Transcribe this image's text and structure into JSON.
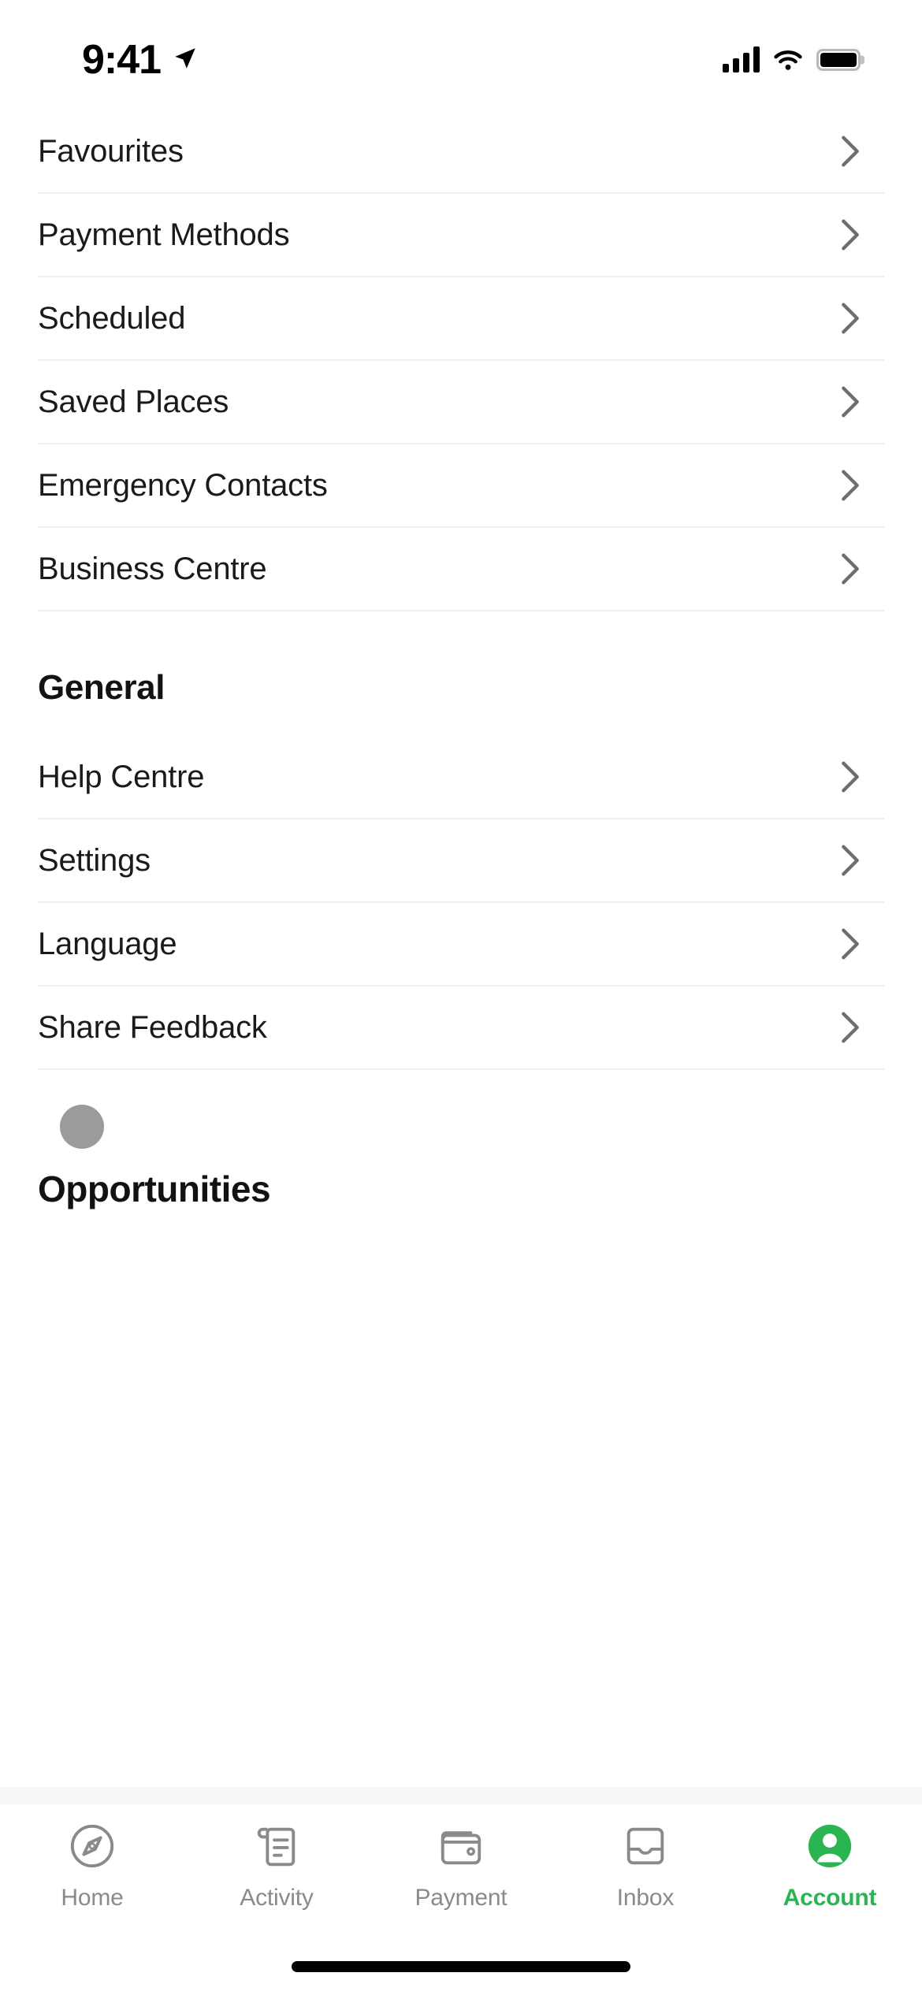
{
  "status_bar": {
    "time": "9:41",
    "location_icon": "location-arrow-icon",
    "signal_icon": "cellular-signal-icon",
    "wifi_icon": "wifi-icon",
    "battery_icon": "battery-full-icon"
  },
  "account_menu": {
    "items": [
      {
        "label": "Favourites",
        "chevron": "chevron-right-icon"
      },
      {
        "label": "Payment Methods",
        "chevron": "chevron-right-icon"
      },
      {
        "label": "Scheduled",
        "chevron": "chevron-right-icon"
      },
      {
        "label": "Saved Places",
        "chevron": "chevron-right-icon"
      },
      {
        "label": "Emergency Contacts",
        "chevron": "chevron-right-icon"
      },
      {
        "label": "Business Centre",
        "chevron": "chevron-right-icon"
      }
    ]
  },
  "general_section": {
    "title": "General",
    "items": [
      {
        "label": "Help Centre",
        "chevron": "chevron-right-icon"
      },
      {
        "label": "Settings",
        "chevron": "chevron-right-icon"
      },
      {
        "label": "Language",
        "chevron": "chevron-right-icon"
      },
      {
        "label": "Share Feedback",
        "chevron": "chevron-right-icon"
      }
    ]
  },
  "opportunities_section": {
    "title": "Opportunities",
    "badge_icon": "circle-placeholder-icon"
  },
  "tab_bar": {
    "tabs": [
      {
        "label": "Home",
        "icon": "compass-icon",
        "active": false
      },
      {
        "label": "Activity",
        "icon": "receipt-icon",
        "active": false
      },
      {
        "label": "Payment",
        "icon": "wallet-icon",
        "active": false
      },
      {
        "label": "Inbox",
        "icon": "inbox-tray-icon",
        "active": false
      },
      {
        "label": "Account",
        "icon": "person-filled-icon",
        "active": true
      }
    ]
  },
  "colors": {
    "accent_green": "#2ab552",
    "divider": "#eeeeee",
    "text_primary": "#1a1a1a",
    "tab_inactive": "#8a8a8a",
    "placeholder_gray": "#9b9b9b"
  },
  "home_indicator": "home-indicator-bar"
}
